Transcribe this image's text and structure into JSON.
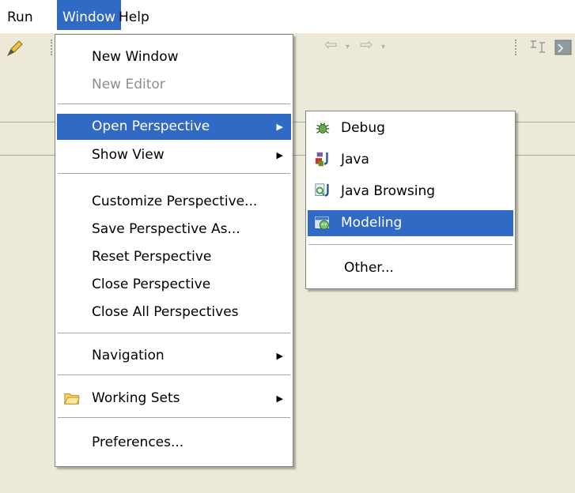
{
  "menubar": {
    "items": [
      {
        "label": "Run"
      },
      {
        "label": "Window"
      },
      {
        "label": "Help"
      }
    ]
  },
  "window_menu": {
    "new_window": "New Window",
    "new_editor": "New Editor",
    "open_perspective": "Open Perspective",
    "show_view": "Show View",
    "customize_perspective": "Customize Perspective...",
    "save_perspective_as": "Save Perspective As...",
    "reset_perspective": "Reset Perspective",
    "close_perspective": "Close Perspective",
    "close_all_perspectives": "Close All Perspectives",
    "navigation": "Navigation",
    "working_sets": "Working Sets",
    "preferences": "Preferences..."
  },
  "perspective_submenu": {
    "debug": "Debug",
    "java": "Java",
    "java_browsing": "Java Browsing",
    "modeling": "Modeling",
    "other": "Other..."
  },
  "colors": {
    "highlight": "#316ac5",
    "background": "#ece9d8"
  }
}
